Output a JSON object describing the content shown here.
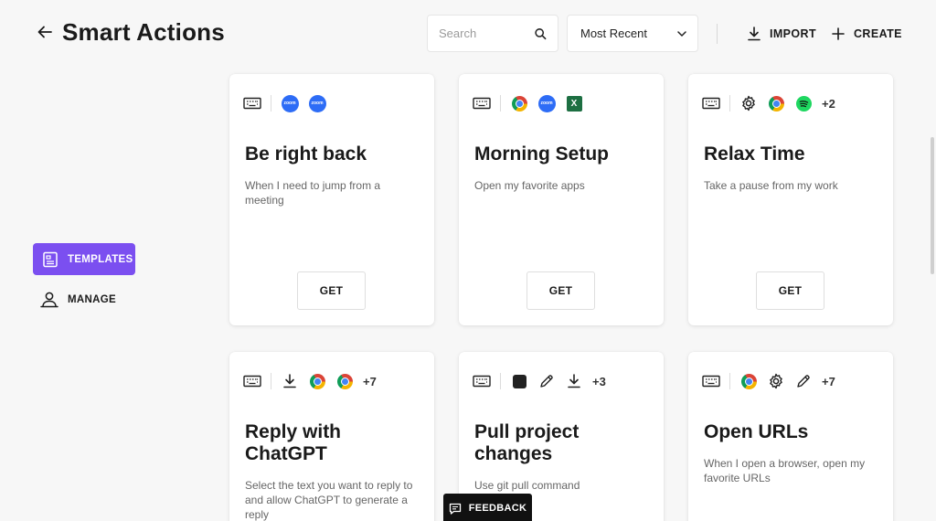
{
  "header": {
    "title": "Smart Actions",
    "search_placeholder": "Search",
    "sort_value": "Most Recent",
    "import_label": "IMPORT",
    "create_label": "CREATE"
  },
  "nav": {
    "templates_label": "TEMPLATES",
    "manage_label": "MANAGE"
  },
  "colors": {
    "accent": "#7b4ff0",
    "zoom": "#2d6cf6"
  },
  "cards": [
    {
      "title": "Be right back",
      "description": "When I need to jump from a meeting",
      "icons": [
        "keyboard-icon",
        "zoom-icon",
        "zoom-icon"
      ],
      "more": "",
      "action": "GET"
    },
    {
      "title": "Morning Setup",
      "description": "Open my favorite apps",
      "icons": [
        "keyboard-icon",
        "chrome-icon",
        "zoom-icon",
        "excel-icon"
      ],
      "more": "",
      "action": "GET"
    },
    {
      "title": "Relax Time",
      "description": "Take a pause from my work",
      "icons": [
        "keyboard-icon",
        "gear-icon",
        "chrome-icon",
        "spotify-icon"
      ],
      "more": "+2",
      "action": "GET"
    },
    {
      "title": "Reply with ChatGPT",
      "description": "Select the text you want to reply to and allow ChatGPT to generate a reply",
      "icons": [
        "keyboard-icon",
        "download-icon",
        "chrome-icon",
        "chrome-icon"
      ],
      "more": "+7"
    },
    {
      "title": "Pull project changes",
      "description": "Use git pull command",
      "icons": [
        "keyboard-icon",
        "terminal-icon",
        "pencil-icon",
        "download-icon"
      ],
      "more": "+3"
    },
    {
      "title": "Open URLs",
      "description": "When I open a browser, open my favorite URLs",
      "icons": [
        "keyboard-icon",
        "chrome-icon",
        "gear-icon",
        "pencil-icon"
      ],
      "more": "+7"
    }
  ],
  "zoom_icon_text": "zoom",
  "excel_icon_text": "X",
  "feedback_label": "FEEDBACK"
}
